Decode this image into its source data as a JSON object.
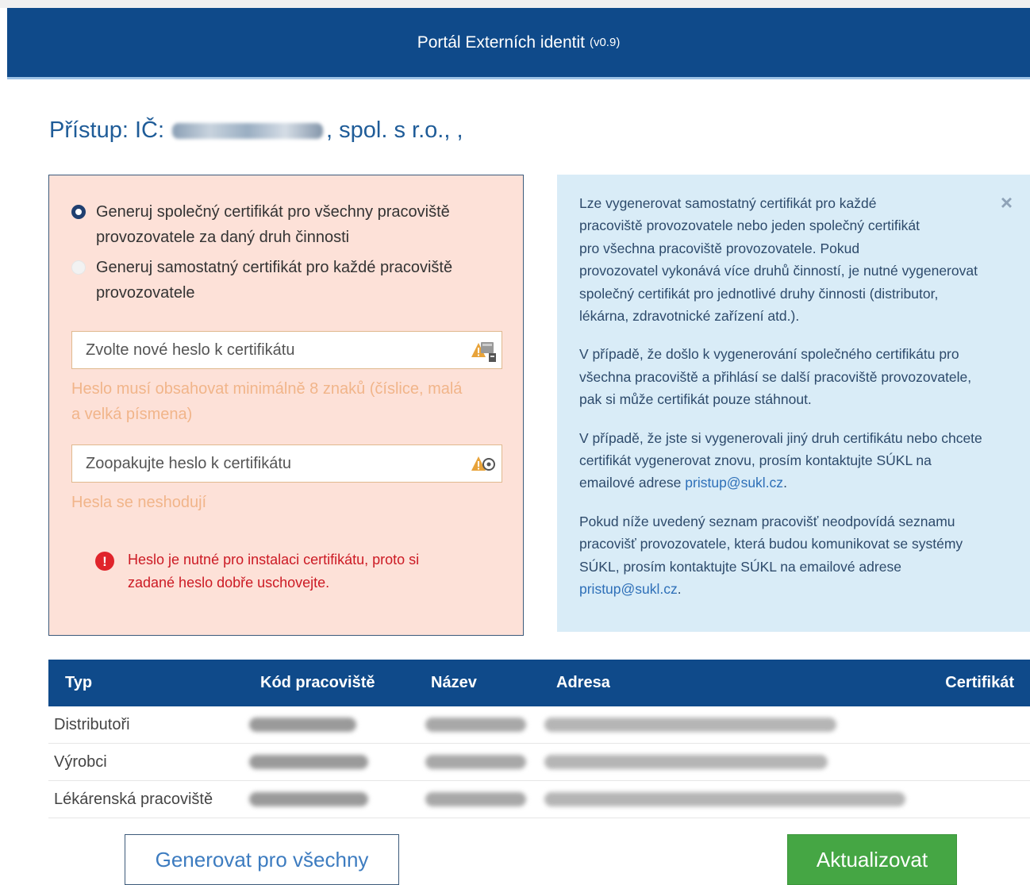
{
  "header": {
    "title": "Portál Externích identit",
    "version": "(v0.9)"
  },
  "page": {
    "title_prefix": "Přístup: IČ:",
    "title_suffix": ", spol. s r.o., ,"
  },
  "form": {
    "radio_options": [
      {
        "line1": "Generuj společný certifikát pro všechny pracoviště",
        "line2": "provozovatele za daný druh činnosti",
        "selected": true
      },
      {
        "line1": "Generuj samostatný certifikát pro každé pracoviště",
        "line2": "provozovatele",
        "selected": false
      }
    ],
    "password_placeholder": "Zvolte nové heslo k certifikátu",
    "password_hint_line1": "Heslo musí obsahovat minimálně 8 znaků (číslice, malá",
    "password_hint_line2": "a velká písmena)",
    "repeat_placeholder": "Zoopakujte heslo k certifikátu",
    "repeat_hint": "Hesla se neshodují",
    "alert_line1": "Heslo je nutné pro instalaci certifikátu, proto si",
    "alert_line2": "zadané heslo dobře uschovejte.",
    "alert_icon": "!"
  },
  "info": {
    "close": "×",
    "p1": [
      "Lze vygenerovat samostatný certifikát pro každé",
      "pracoviště provozovatele nebo jeden společný certifikát",
      "pro všechna pracoviště provozovatele. Pokud",
      "provozovatel vykonává více druhů činností, je nutné vygenerovat",
      "společný certifikát pro jednotlivé druhy činnosti (distributor,",
      "lékárna, zdravotnické zařízení atd.)."
    ],
    "p2": [
      "V případě, že došlo k vygenerování společného certifikátu pro",
      "všechna pracoviště a přihlásí se další pracoviště provozovatele,",
      "pak si může certifikát pouze stáhnout."
    ],
    "p3": [
      "V případě, že jste si vygenerovali jiný druh certifikátu nebo chcete",
      "certifikát vygenerovat znovu, prosím kontaktujte SÚKL na"
    ],
    "p3_last_prefix": "emailové adrese ",
    "p3_link": "pristup@sukl.cz",
    "p3_last_suffix": ".",
    "p4": [
      "Pokud níže uvedený seznam pracovišť neodpovídá seznamu",
      "pracovišť provozovatele, která budou komunikovat se systémy",
      "SÚKL, prosím kontaktujte SÚKL na emailové adrese"
    ],
    "p4_link": "pristup@sukl.cz",
    "p4_suffix": "."
  },
  "table": {
    "headers": {
      "type": "Typ",
      "code": "Kód pracoviště",
      "name": "Název",
      "address": "Adresa",
      "certificate": "Certifikát"
    },
    "rows": [
      {
        "type": "Distributoři"
      },
      {
        "type": "Výrobci"
      },
      {
        "type": "Lékárenská pracoviště"
      }
    ]
  },
  "buttons": {
    "generate_all": "Generovat pro všechny",
    "update": "Aktualizovat"
  },
  "colors": {
    "header_bg": "#0f4a8a",
    "accent_green": "#45a644",
    "warning_orange": "#f1b58a",
    "error_red": "#cc1a24"
  }
}
